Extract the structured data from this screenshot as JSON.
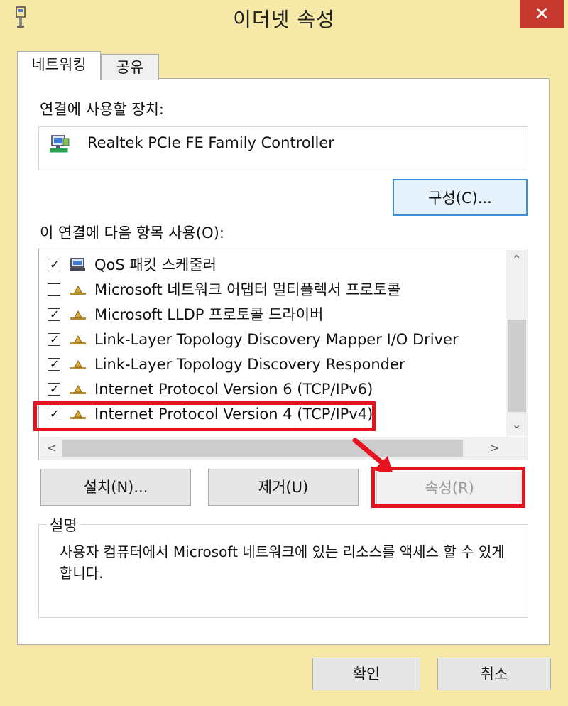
{
  "window": {
    "title": "이더넷 속성",
    "close_symbol": "✕",
    "title_icon": "network-adapter-icon"
  },
  "tabs": [
    {
      "label": "네트워킹",
      "active": true
    },
    {
      "label": "공유",
      "active": false
    }
  ],
  "connect_using": {
    "label": "연결에 사용할 장치:",
    "device_name": "Realtek PCIe FE Family Controller",
    "device_icon": "network-device-icon",
    "configure_button": "구성(C)..."
  },
  "items_section": {
    "label": "이 연결에 다음 항목 사용(O):",
    "items": [
      {
        "label": "QoS 패킷 스케줄러",
        "checked": true,
        "icon": "qos-computer-icon"
      },
      {
        "label": "Microsoft 네트워크 어댑터 멀티플렉서 프로토콜",
        "checked": false,
        "icon": "protocol-icon"
      },
      {
        "label": "Microsoft LLDP 프로토콜 드라이버",
        "checked": true,
        "icon": "protocol-icon"
      },
      {
        "label": "Link-Layer Topology Discovery Mapper I/O Driver",
        "checked": true,
        "icon": "protocol-icon"
      },
      {
        "label": "Link-Layer Topology Discovery Responder",
        "checked": true,
        "icon": "protocol-icon"
      },
      {
        "label": "Internet Protocol Version 6 (TCP/IPv6)",
        "checked": true,
        "icon": "protocol-icon"
      },
      {
        "label": "Internet Protocol Version 4 (TCP/IPv4)",
        "checked": true,
        "icon": "protocol-icon",
        "highlighted": true
      }
    ],
    "scroll_up": "⌃",
    "scroll_down": "⌄",
    "scroll_left": "<",
    "scroll_right": ">"
  },
  "buttons": {
    "install": "설치(N)...",
    "uninstall": "제거(U)",
    "properties": "속성(R)",
    "ok": "확인",
    "cancel": "취소"
  },
  "description": {
    "title": "설명",
    "text": "사용자 컴퓨터에서 Microsoft 네트워크에 있는 리소스를 액세스 할 수 있게 합니다."
  },
  "colors": {
    "title_bar": "#f6e9a8",
    "close_button": "#c7382f",
    "annotation": "#e8121f",
    "focus_border": "#3c90de"
  }
}
